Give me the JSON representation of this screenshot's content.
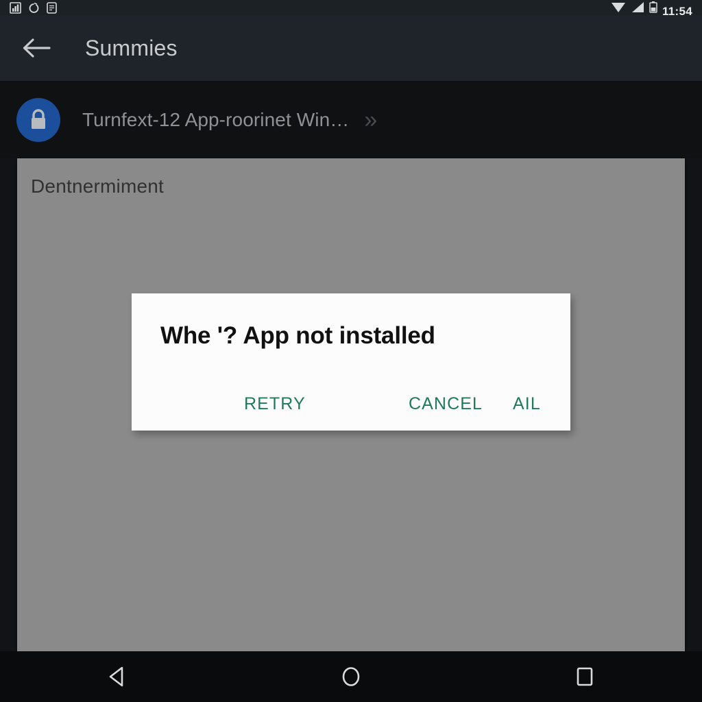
{
  "status_bar": {
    "left_icons": [
      "signal-bars-notification-icon",
      "sync-circle-icon",
      "message-icon"
    ],
    "right_icons": [
      "wifi-icon",
      "cell-signal-icon",
      "battery-icon"
    ],
    "time": "11:54"
  },
  "app_bar": {
    "back_icon": "back-arrow-icon",
    "title": "Summies"
  },
  "breadcrumb": {
    "avatar_icon": "lock-icon",
    "avatar_color": "#1b4f9c",
    "text": "Turnfext-12 App-roorinet Win…",
    "expand_icon": "double-chevron-right-icon",
    "expand_glyph": "»"
  },
  "content": {
    "heading": "Dentnermiment",
    "background": "#8a8a8a"
  },
  "dialog": {
    "title": "Whe '? App not installed",
    "accent_color": "#1f7a5c",
    "buttons": [
      {
        "label": "RETRY"
      },
      {
        "label": "CANCEL"
      },
      {
        "label": "AIL"
      }
    ]
  },
  "nav_bar": {
    "back_icon": "nav-back-triangle-icon",
    "home_icon": "nav-home-circle-icon",
    "recents_icon": "nav-recents-square-icon"
  }
}
